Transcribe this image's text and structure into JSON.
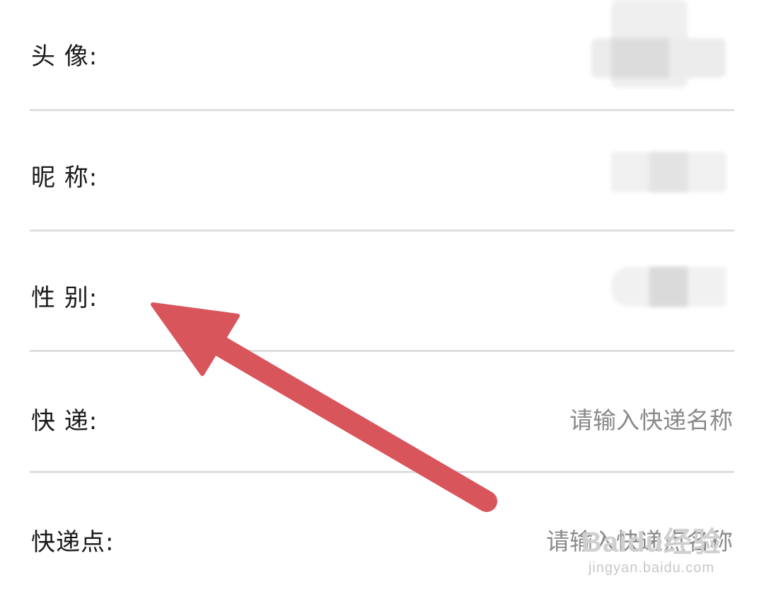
{
  "form": {
    "avatar_label": "头  像:",
    "nickname_label": "昵  称:",
    "gender_label": "性  别:",
    "express_label": "快  递:",
    "express_placeholder": "请输入快递名称",
    "express_point_label": "快递点:",
    "express_point_placeholder": "请输入快递点名称"
  },
  "watermark": {
    "logo": "Baidu经验",
    "url": "jingyan.baidu.com"
  },
  "colors": {
    "arrow": "#d9555c",
    "divider": "#dedede",
    "placeholder": "#8a8a8a"
  }
}
